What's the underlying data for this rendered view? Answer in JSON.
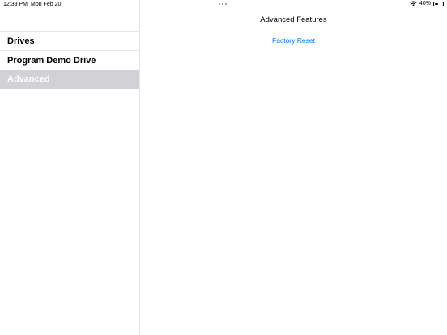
{
  "status_bar": {
    "time": "12:39 PM",
    "date": "Mon Feb 20",
    "battery_percent": "40%",
    "battery_level": 0.4
  },
  "sidebar": {
    "items": [
      {
        "label": "Drives",
        "selected": false
      },
      {
        "label": "Program Demo Drive",
        "selected": false
      },
      {
        "label": "Advanced",
        "selected": true
      }
    ]
  },
  "detail": {
    "title": "Advanced Features",
    "actions": [
      {
        "label": "Factory Reset"
      }
    ]
  },
  "colors": {
    "accent": "#007aff",
    "selection": "#d1d1d6",
    "separator": "#e5e5ea"
  },
  "icons": [
    "wifi-icon",
    "battery-icon",
    "multitask-dots-icon"
  ]
}
